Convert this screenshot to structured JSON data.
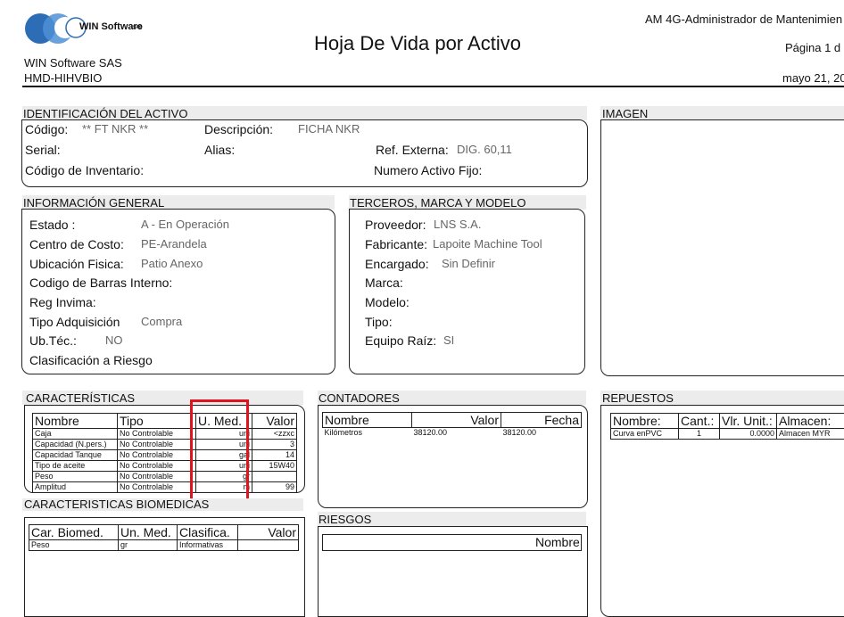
{
  "header": {
    "logo_text": "WIN Software",
    "logo_suffix": "SAS",
    "title": "Hoja De Vida por Activo",
    "app_name": "AM 4G-Administrador de Mantenimien",
    "page": "Página 1 d",
    "company": "WIN Software SAS",
    "report_code": "HMD-HIHVBIO",
    "date": "mayo 21, 20"
  },
  "identificacion": {
    "title": "IDENTIFICACIÓN DEL ACTIVO",
    "codigo_label": "Código:",
    "codigo_value": "** FT NKR **",
    "descripcion_label": "Descripción:",
    "descripcion_value": "FICHA NKR",
    "serial_label": "Serial:",
    "alias_label": "Alias:",
    "ref_label": "Ref. Externa:",
    "ref_value": "DIG. 60,11",
    "inventario_label": "Código de Inventario:",
    "activo_fijo_label": "Numero Activo Fijo:"
  },
  "imagen": {
    "title": "IMAGEN"
  },
  "general": {
    "title": "INFORMACIÓN GENERAL",
    "estado_label": "Estado :",
    "estado_value": "A - En Operación",
    "centro_label": "Centro de Costo:",
    "centro_value": "PE-Arandela",
    "ubicacion_label": "Ubicación Fisica:",
    "ubicacion_value": "Patio Anexo",
    "barras_label": "Codigo de Barras Interno:",
    "invima_label": "Reg Invima:",
    "adquisicion_label": "Tipo Adquisición",
    "adquisicion_value": "Compra",
    "ubtec_label": "Ub.Téc.:",
    "ubtec_value": "NO",
    "riesgo_label": "Clasificación a Riesgo"
  },
  "terceros": {
    "title": "TERCEROS, MARCA Y MODELO",
    "proveedor_label": "Proveedor:",
    "proveedor_value": "LNS S.A.",
    "fabricante_label": "Fabricante:",
    "fabricante_value": "Lapoite Machine Tool",
    "encargado_label": "Encargado:",
    "encargado_value": "Sin Definir",
    "marca_label": "Marca:",
    "modelo_label": "Modelo:",
    "tipo_label": "Tipo:",
    "raiz_label": "Equipo Raíz:",
    "raiz_value": "SI"
  },
  "caracteristicas": {
    "title": "CARACTERÍSTICAS",
    "headers": [
      "Nombre",
      "Tipo",
      "U. Med.",
      "Valor"
    ],
    "rows": [
      [
        "Caja",
        "No Controlable",
        "uni",
        "<zzxc"
      ],
      [
        "Capacidad (N.pers.)",
        "No Controlable",
        "uni",
        "3"
      ],
      [
        "Capacidad Tanque",
        "No Controlable",
        "gal",
        "14"
      ],
      [
        "Tipo de aceite",
        "No Controlable",
        "uni",
        "15W40"
      ],
      [
        "Peso",
        "No Controlable",
        "gr",
        ""
      ],
      [
        "Amplitud",
        "No Controlable",
        "m",
        "99"
      ]
    ]
  },
  "biomedicas": {
    "title": "CARACTERISTICAS BIOMEDICAS",
    "headers": [
      "Car. Biomed.",
      "Un. Med.",
      "Clasifica.",
      "Valor"
    ],
    "rows": [
      [
        "Peso",
        "gr",
        "Informativas",
        ""
      ]
    ]
  },
  "contadores": {
    "title": "CONTADORES",
    "headers": [
      "Nombre",
      "Valor",
      "Fecha"
    ],
    "rows": [
      [
        "Kilómetros",
        "38120.00",
        "38120.00"
      ]
    ]
  },
  "riesgos": {
    "title": "RIESGOS",
    "header": "Nombre"
  },
  "repuestos": {
    "title": "REPUESTOS",
    "headers": [
      "Nombre:",
      "Cant.:",
      "Vlr. Unit.:",
      "Almacen:"
    ],
    "rows": [
      [
        "Curva enPVC",
        "1",
        "0.0000",
        "Almacen MYR"
      ]
    ]
  },
  "colors": {
    "highlight": "#e0141e",
    "section_bg": "#ececec"
  }
}
